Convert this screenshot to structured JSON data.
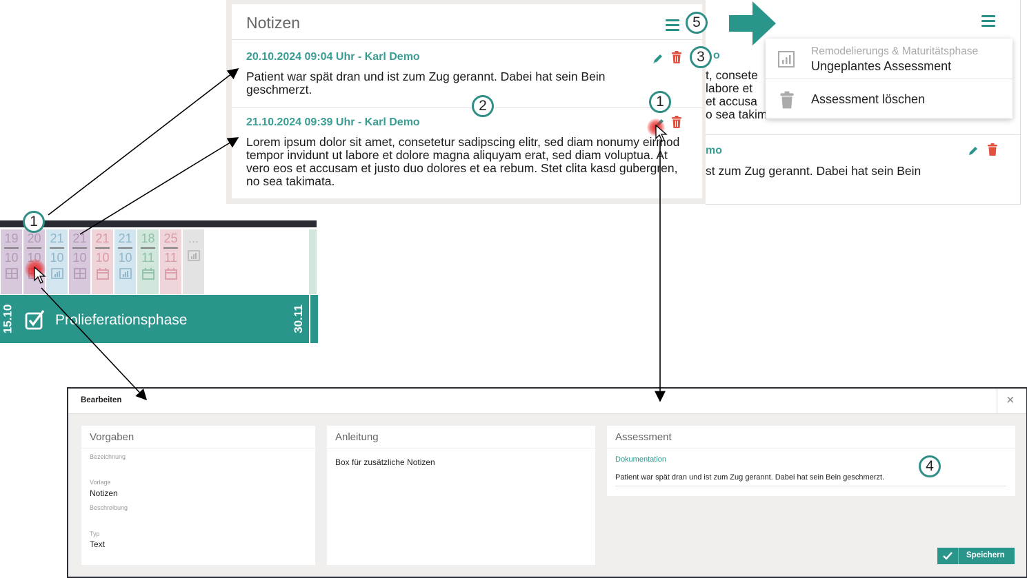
{
  "notes": {
    "title": "Notizen",
    "entries": [
      {
        "header": "20.10.2024 09:04 Uhr - Karl Demo",
        "text": "Patient war spät dran und ist zum Zug gerannt. Dabei hat sein Bein geschmerzt."
      },
      {
        "header": "21.10.2024 09:39 Uhr - Karl Demo",
        "text": "Lorem ipsum dolor sit amet, consetetur sadipscing elitr, sed diam nonumy eirmod tempor invidunt ut labore et dolore magna aliquyam erat, sed diam voluptua. At vero eos et accusam et justo duo dolores et ea rebum. Stet clita kasd gubergren, no sea takimata."
      }
    ]
  },
  "snippet": {
    "partial_header_top": "o",
    "partial_lines": [
      "t, consete",
      "labore et",
      "et accusa",
      "o sea takimata."
    ],
    "partial_header2": "mo",
    "partial_text2": "st zum Zug gerannt. Dabei hat sein Bein"
  },
  "menu": {
    "item1_sub": "Remodelierungs & Maturitätsphase",
    "item1": "Ungeplantes Assessment",
    "item2": "Assessment löschen"
  },
  "badges": {
    "b1": "1",
    "b2": "2",
    "b3": "3",
    "b4": "4",
    "b5": "5"
  },
  "timeline": {
    "days": [
      {
        "d": "19",
        "m": "10",
        "icon": "list-icon",
        "color": "#b399b7",
        "bg": "#d8c8dc"
      },
      {
        "d": "20",
        "m": "10",
        "icon": "list-icon",
        "color": "#b399b7",
        "bg": "#d8c8dc"
      },
      {
        "d": "21",
        "m": "10",
        "icon": "chart-icon",
        "color": "#8fb7cc",
        "bg": "#d3e5ee"
      },
      {
        "d": "21",
        "m": "10",
        "icon": "list-icon",
        "color": "#b399b7",
        "bg": "#d8c8dc"
      },
      {
        "d": "21",
        "m": "10",
        "icon": "calendar-icon",
        "color": "#d99aa6",
        "bg": "#efd4d9"
      },
      {
        "d": "21",
        "m": "10",
        "icon": "chart-icon",
        "color": "#8fb7cc",
        "bg": "#d3e5ee"
      },
      {
        "d": "18",
        "m": "11",
        "icon": "calendar-icon",
        "color": "#8fbfa9",
        "bg": "#d2e7dc"
      },
      {
        "d": "25",
        "m": "11",
        "icon": "calendar-icon",
        "color": "#d99aa6",
        "bg": "#efd4d9"
      },
      {
        "d": "...",
        "m": "",
        "icon": "chart-icon",
        "color": "#b5b5b5",
        "bg": "#e3e3e3"
      }
    ],
    "phase_start": "15.10",
    "phase_label": "Prolieferationsphase",
    "phase_end": "30.11"
  },
  "dialog": {
    "title": "Bearbeiten",
    "close": "×",
    "vorgaben": {
      "title": "Vorgaben",
      "bezeichnung_label": "Bezeichnung",
      "vorlage_label": "Vorlage",
      "vorlage_value": "Notizen",
      "beschreibung_label": "Beschreibung",
      "typ_label": "Typ",
      "typ_value": "Text"
    },
    "anleitung": {
      "title": "Anleitung",
      "text": "Box für zusätzliche Notizen"
    },
    "assessment": {
      "title": "Assessment",
      "doc_label": "Dokumentation",
      "doc_value": "Patient war spät dran und ist zum Zug gerannt. Dabei hat sein Bein geschmerzt."
    },
    "save": "Speichern"
  },
  "colors": {
    "teal": "#2a958b",
    "delete": "#e0513f"
  }
}
